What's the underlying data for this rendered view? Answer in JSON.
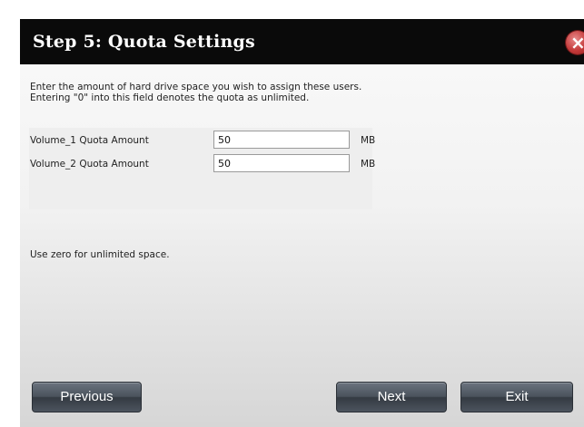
{
  "dialog": {
    "title": "Step 5: Quota Settings",
    "close_symbol": "×",
    "close_icon": "close-x-icon",
    "close_color": "#c43a3a"
  },
  "description": {
    "line1": "Enter the amount of hard drive space you wish to assign these users.",
    "line2": "Entering \"0\" into this field denotes the quota as unlimited."
  },
  "quotas": [
    {
      "label": "Volume_1 Quota Amount",
      "value": "50",
      "unit": "MB"
    },
    {
      "label": "Volume_2 Quota Amount",
      "value": "50",
      "unit": "MB"
    }
  ],
  "hint": "Use zero for unlimited space.",
  "buttons": {
    "previous": "Previous",
    "next": "Next",
    "exit": "Exit"
  }
}
